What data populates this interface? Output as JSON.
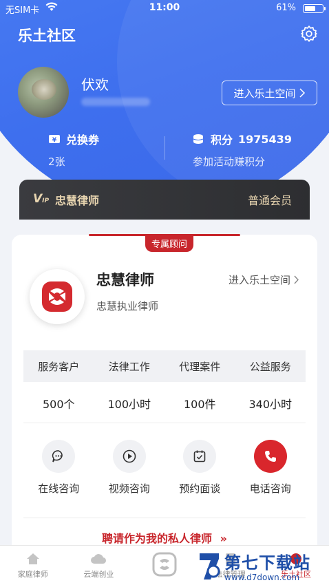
{
  "status_bar": {
    "carrier": "无SIM卡",
    "time": "11:00",
    "battery": "61%"
  },
  "header": {
    "title": "乐土社区"
  },
  "profile": {
    "name": "伏欢",
    "space_button": "进入乐土空间"
  },
  "coupon": {
    "label": "兑换券",
    "value": "2张"
  },
  "points": {
    "label": "积分",
    "value": "1975439",
    "sub": "参加活动赚积分"
  },
  "vip": {
    "name": "忠慧律师",
    "level": "普通会员"
  },
  "card": {
    "tag": "专属顾问",
    "lawyer_name": "忠慧律师",
    "lawyer_title": "忠慧执业律师",
    "space_link": "进入乐土空间",
    "stat_headers": [
      "服务客户",
      "法律工作",
      "代理案件",
      "公益服务"
    ],
    "stat_values": [
      "500个",
      "100小时",
      "100件",
      "340小时"
    ],
    "actions": [
      "在线咨询",
      "视频咨询",
      "预约面谈",
      "电话咨询"
    ],
    "hire_text": "聘请作为我的私人律师"
  },
  "tabbar": {
    "items": [
      "家庭律师",
      "云端创业",
      "",
      "法律管理",
      "乐土社区"
    ]
  },
  "watermark": {
    "title": "第七下载站",
    "url": "www.d7down.com"
  },
  "colors": {
    "primary_blue": "#3e6fee",
    "accent_red": "#c8262c",
    "vip_gold": "#e8d5b0"
  }
}
